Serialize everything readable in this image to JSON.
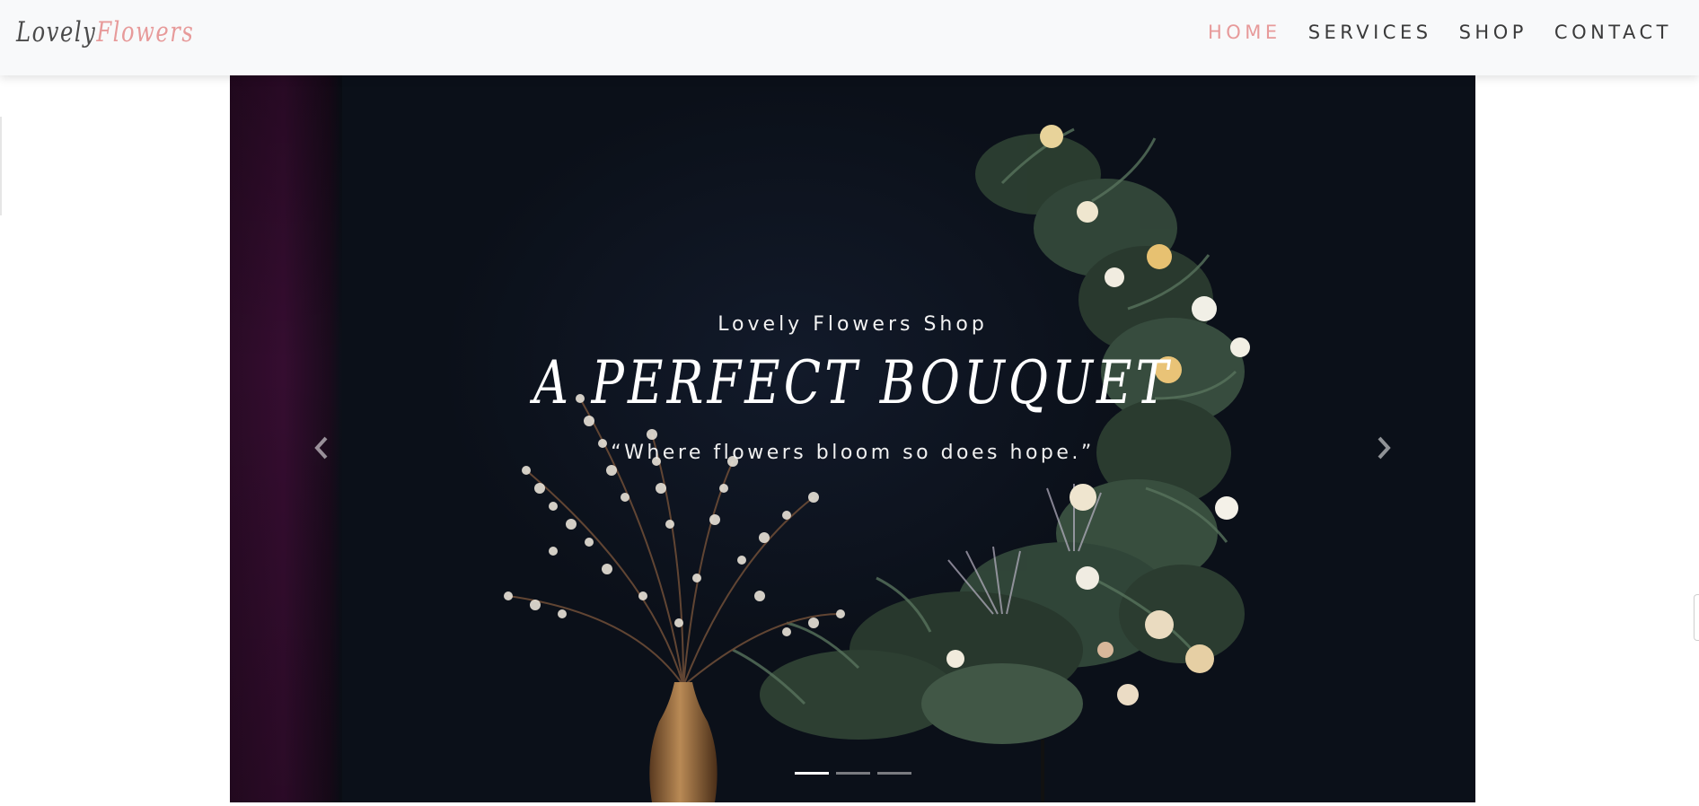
{
  "brand": {
    "part_a": "Lovely",
    "part_b": "Flowers"
  },
  "nav": {
    "items": [
      {
        "label": "HOME",
        "active": true
      },
      {
        "label": "SERVICES",
        "active": false
      },
      {
        "label": "SHOP",
        "active": false
      },
      {
        "label": "CONTACT",
        "active": false
      }
    ]
  },
  "hero": {
    "subtitle": "Lovely Flowers Shop",
    "title": "A PERFECT BOUQUET",
    "quote": "“Where flowers bloom so does hope.”",
    "prev_icon": "chevron-left-icon",
    "next_icon": "chevron-right-icon",
    "indicators": [
      {
        "active": true
      },
      {
        "active": false
      },
      {
        "active": false
      }
    ]
  },
  "colors": {
    "accent": "#e79a9a",
    "nav_text": "#3a3a3a",
    "navbar_bg": "#f8f9fa",
    "hero_bg": "#0b1019"
  }
}
